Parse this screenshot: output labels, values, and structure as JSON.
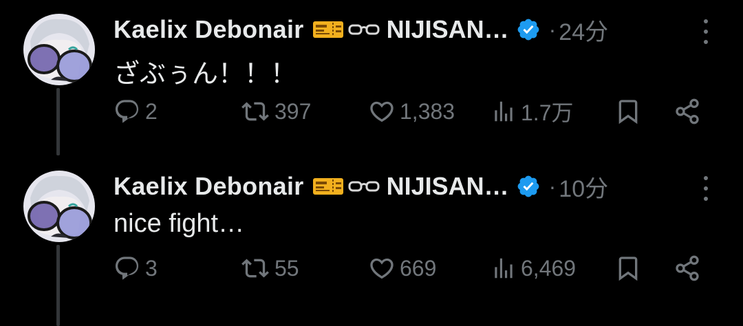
{
  "thread": [
    {
      "author": {
        "name": "Kaelix Debonair",
        "org": "NIJISAN…",
        "emoji": [
          "ticket-icon",
          "glasses-icon"
        ],
        "verified": true
      },
      "time": "24分",
      "text": "ざぶぅん！！！",
      "stats": {
        "replies": "2",
        "reposts": "397",
        "likes": "1,383",
        "views": "1.7万"
      }
    },
    {
      "author": {
        "name": "Kaelix Debonair",
        "org": "NIJISAN…",
        "emoji": [
          "ticket-icon",
          "glasses-icon"
        ],
        "verified": true
      },
      "time": "10分",
      "text": "nice fight…",
      "stats": {
        "replies": "3",
        "reposts": "55",
        "likes": "669",
        "views": "6,469"
      }
    }
  ],
  "colors": {
    "background": "#000000",
    "text": "#e7e9ea",
    "muted": "#71767b",
    "verified": "#1d9bf0",
    "thread_line": "#333639"
  }
}
